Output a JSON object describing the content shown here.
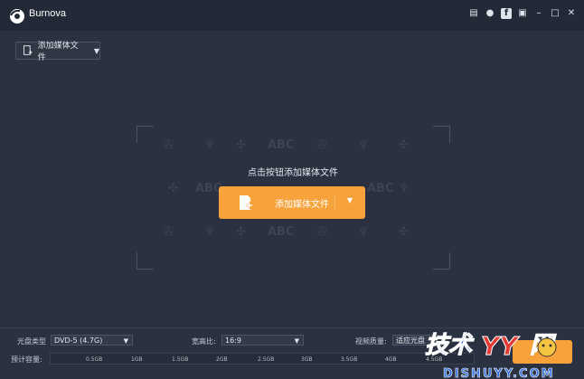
{
  "app": {
    "title": "Burnova"
  },
  "toolbar": {
    "add_label": "添加媒体文件"
  },
  "dropzone": {
    "hint": "点击按钮添加媒体文件",
    "button_label": "添加媒体文件",
    "watermark_text": "ABC"
  },
  "bottom": {
    "disc_type_label": "光盘类型",
    "disc_type_value": "DVD-5 (4.7G)",
    "aspect_label": "宽高比:",
    "aspect_value": "16:9",
    "quality_label": "视频质量:",
    "quality_value": "适应光盘",
    "capacity_label": "预计容量:",
    "ticks": [
      "0.5GB",
      "1GB",
      "1.5GB",
      "2GB",
      "2.5GB",
      "3GB",
      "3.5GB",
      "4GB",
      "4.5GB"
    ]
  },
  "watermark": {
    "site": "技术YY网",
    "url": "DISHUYY.COM"
  },
  "colors": {
    "accent": "#f7a23b",
    "background": "#2b3140",
    "titlebar": "#232936"
  }
}
